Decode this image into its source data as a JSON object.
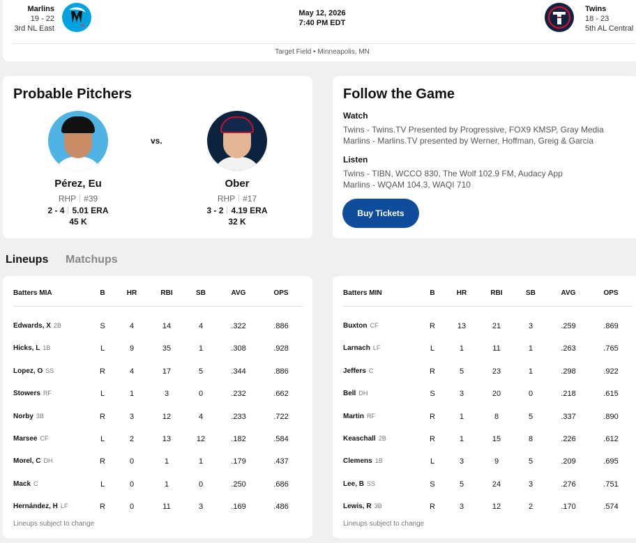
{
  "header": {
    "away": {
      "name": "Marlins",
      "record": "19 - 22",
      "standing": "3rd NL East"
    },
    "home": {
      "name": "Twins",
      "record": "18 - 23",
      "standing": "5th AL Central"
    },
    "date": "May 12, 2026",
    "time": "7:40 PM EDT",
    "venue": "Target Field • Minneapolis, MN",
    "colors": {
      "marlins": "#00a3e0",
      "twins": "#0c2340",
      "twins_red": "#c4122e"
    }
  },
  "pitchers": {
    "title": "Probable Pitchers",
    "vs": "vs.",
    "away": {
      "name": "Pérez, Eu",
      "throws": "RHP",
      "number": "#39",
      "record": "2 - 4",
      "era": "5.01 ERA",
      "k": "45 K"
    },
    "home": {
      "name": "Ober",
      "throws": "RHP",
      "number": "#17",
      "record": "3 - 2",
      "era": "4.19 ERA",
      "k": "32 K"
    }
  },
  "follow": {
    "title": "Follow the Game",
    "watch_heading": "Watch",
    "watch": [
      "Twins - Twins.TV Presented by Progressive, FOX9 KMSP, Gray Media",
      "Marlins - Marlins.TV presented by Werner, Hoffman, Greig & Garcia"
    ],
    "listen_heading": "Listen",
    "listen": [
      "Twins - TIBN, WCCO 830, The Wolf 102.9 FM, Audacy App",
      "Marlins - WQAM 104.3, WAQI 710"
    ],
    "buy_label": "Buy Tickets",
    "button_color": "#0f4c9c"
  },
  "tabs": {
    "lineups": "Lineups",
    "matchups": "Matchups"
  },
  "lineups": {
    "columns": [
      "B",
      "HR",
      "RBI",
      "SB",
      "AVG",
      "OPS"
    ],
    "note": "Lineups subject to change",
    "away": {
      "header": "Batters MIA",
      "rows": [
        {
          "name": "Edwards, X",
          "pos": "2B",
          "b": "S",
          "hr": "4",
          "rbi": "14",
          "sb": "4",
          "avg": ".322",
          "ops": ".886"
        },
        {
          "name": "Hicks, L",
          "pos": "1B",
          "b": "L",
          "hr": "9",
          "rbi": "35",
          "sb": "1",
          "avg": ".308",
          "ops": ".928"
        },
        {
          "name": "Lopez, O",
          "pos": "SS",
          "b": "R",
          "hr": "4",
          "rbi": "17",
          "sb": "5",
          "avg": ".344",
          "ops": ".886"
        },
        {
          "name": "Stowers",
          "pos": "RF",
          "b": "L",
          "hr": "1",
          "rbi": "3",
          "sb": "0",
          "avg": ".232",
          "ops": ".662"
        },
        {
          "name": "Norby",
          "pos": "3B",
          "b": "R",
          "hr": "3",
          "rbi": "12",
          "sb": "4",
          "avg": ".233",
          "ops": ".722"
        },
        {
          "name": "Marsee",
          "pos": "CF",
          "b": "L",
          "hr": "2",
          "rbi": "13",
          "sb": "12",
          "avg": ".182",
          "ops": ".584"
        },
        {
          "name": "Morel, C",
          "pos": "DH",
          "b": "R",
          "hr": "0",
          "rbi": "1",
          "sb": "1",
          "avg": ".179",
          "ops": ".437"
        },
        {
          "name": "Mack",
          "pos": "C",
          "b": "L",
          "hr": "0",
          "rbi": "1",
          "sb": "0",
          "avg": ".250",
          "ops": ".686"
        },
        {
          "name": "Hernández, H",
          "pos": "LF",
          "b": "R",
          "hr": "0",
          "rbi": "11",
          "sb": "3",
          "avg": ".169",
          "ops": ".486"
        }
      ]
    },
    "home": {
      "header": "Batters MIN",
      "rows": [
        {
          "name": "Buxton",
          "pos": "CF",
          "b": "R",
          "hr": "13",
          "rbi": "21",
          "sb": "3",
          "avg": ".259",
          "ops": ".869"
        },
        {
          "name": "Larnach",
          "pos": "LF",
          "b": "L",
          "hr": "1",
          "rbi": "11",
          "sb": "1",
          "avg": ".263",
          "ops": ".765"
        },
        {
          "name": "Jeffers",
          "pos": "C",
          "b": "R",
          "hr": "5",
          "rbi": "23",
          "sb": "1",
          "avg": ".298",
          "ops": ".922"
        },
        {
          "name": "Bell",
          "pos": "DH",
          "b": "S",
          "hr": "3",
          "rbi": "20",
          "sb": "0",
          "avg": ".218",
          "ops": ".615"
        },
        {
          "name": "Martin",
          "pos": "RF",
          "b": "R",
          "hr": "1",
          "rbi": "8",
          "sb": "5",
          "avg": ".337",
          "ops": ".890"
        },
        {
          "name": "Keaschall",
          "pos": "2B",
          "b": "R",
          "hr": "1",
          "rbi": "15",
          "sb": "8",
          "avg": ".226",
          "ops": ".612"
        },
        {
          "name": "Clemens",
          "pos": "1B",
          "b": "L",
          "hr": "3",
          "rbi": "9",
          "sb": "5",
          "avg": ".209",
          "ops": ".695"
        },
        {
          "name": "Lee, B",
          "pos": "SS",
          "b": "S",
          "hr": "5",
          "rbi": "24",
          "sb": "3",
          "avg": ".276",
          "ops": ".751"
        },
        {
          "name": "Lewis, R",
          "pos": "3B",
          "b": "R",
          "hr": "3",
          "rbi": "12",
          "sb": "2",
          "avg": ".170",
          "ops": ".574"
        }
      ]
    }
  }
}
